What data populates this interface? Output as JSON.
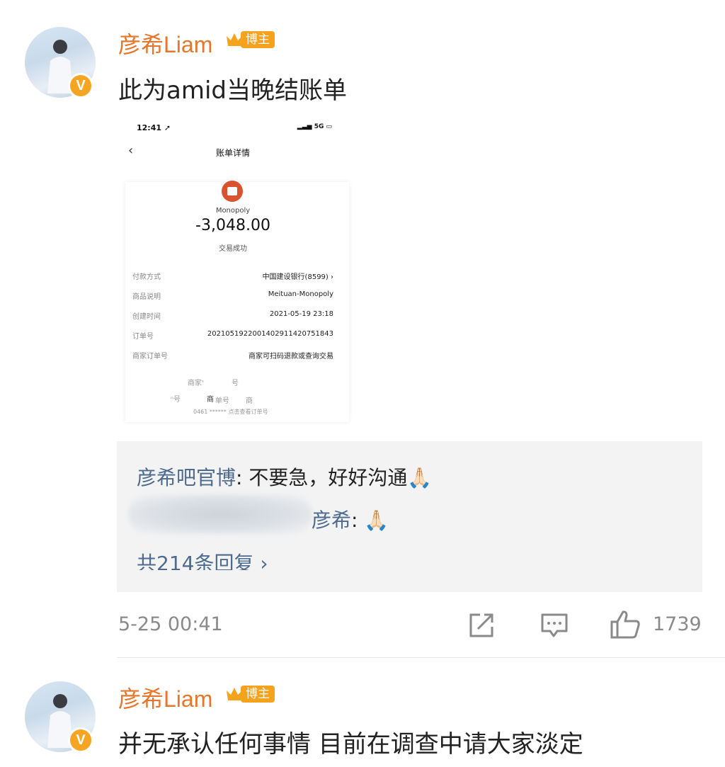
{
  "posts": [
    {
      "username": "彦希Liam",
      "badge": "博主",
      "verified_mark": "V",
      "text": "此为amid当晚结账单",
      "attachment": {
        "status_time": "12:41 ➚",
        "status_right": "5G",
        "nav_title": "账单详情",
        "back": "‹",
        "merchant": "Monopoly",
        "amount": "-3,048.00",
        "status": "交易成功",
        "rows": [
          {
            "label": "付款方式",
            "value": "中国建设银行(8599)  ›"
          },
          {
            "label": "商品说明",
            "value": "Meituan-Monopoly"
          },
          {
            "label": "创建时间",
            "value": "2021-05-19 23:18"
          },
          {
            "label": "订单号",
            "value": "2021051922001402911420751843"
          },
          {
            "label": "商家订单号",
            "value": "商家可扫码退款或查询交易"
          }
        ],
        "ghost_lines": [
          "商家'",
          "号",
          "ⁿ号",
          "商",
          "单号",
          "商",
          "0461 ****** 点击查看订单号"
        ]
      },
      "replies": [
        {
          "author": "彦希吧官博",
          "sep": ": ",
          "text": "不要急，好好沟通🙏🏻"
        },
        {
          "author": "彦希",
          "sep": ": ",
          "text": "🙏🏻"
        }
      ],
      "total_replies": "共214条回复 ›",
      "timestamp": "5-25 00:41",
      "likes": "1739"
    },
    {
      "username": "彦希Liam",
      "badge": "博主",
      "verified_mark": "V",
      "text": "并无承认任何事情 目前在调查中请大家淡定"
    }
  ],
  "icons": [
    "share-icon",
    "comment-icon",
    "like-icon",
    "crown-icon"
  ],
  "colors": {
    "username": "#e5762a",
    "reply_author": "#4d6a8f",
    "badge": "#f5a31c",
    "meta": "#8a8a8a"
  }
}
